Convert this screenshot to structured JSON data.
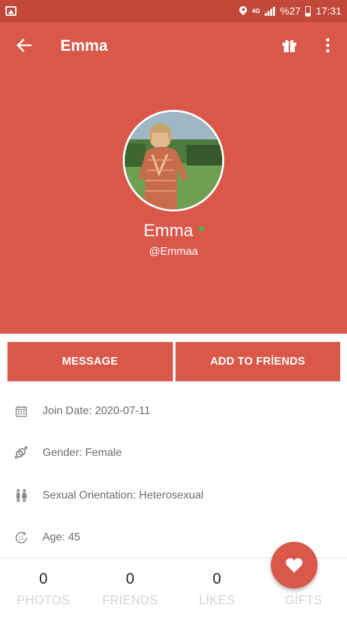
{
  "status_bar": {
    "network": "4G",
    "battery": "%27",
    "time": "17:31"
  },
  "app_bar": {
    "title": "Emma"
  },
  "profile": {
    "name": "Emma",
    "online_color": "#27c93f",
    "username": "@Emmaa"
  },
  "actions": {
    "message": "MESSAGE",
    "add_friend": "ADD TO FRİENDS"
  },
  "info": [
    {
      "icon": "calendar-icon",
      "text": "Join Date: 2020-07-11"
    },
    {
      "icon": "gender-icon",
      "text": "Gender: Female"
    },
    {
      "icon": "couple-icon",
      "text": "Sexual Orientation: Heterosexual"
    },
    {
      "icon": "age-icon",
      "text": "Age: 45"
    }
  ],
  "stats": [
    {
      "value": "0",
      "label": "PHOTOS"
    },
    {
      "value": "0",
      "label": "FRİENDS"
    },
    {
      "value": "0",
      "label": "LİKES"
    },
    {
      "value": "",
      "label": "GİFTS"
    }
  ],
  "colors": {
    "status_bar": "#c2483a",
    "primary": "#d9584a"
  }
}
